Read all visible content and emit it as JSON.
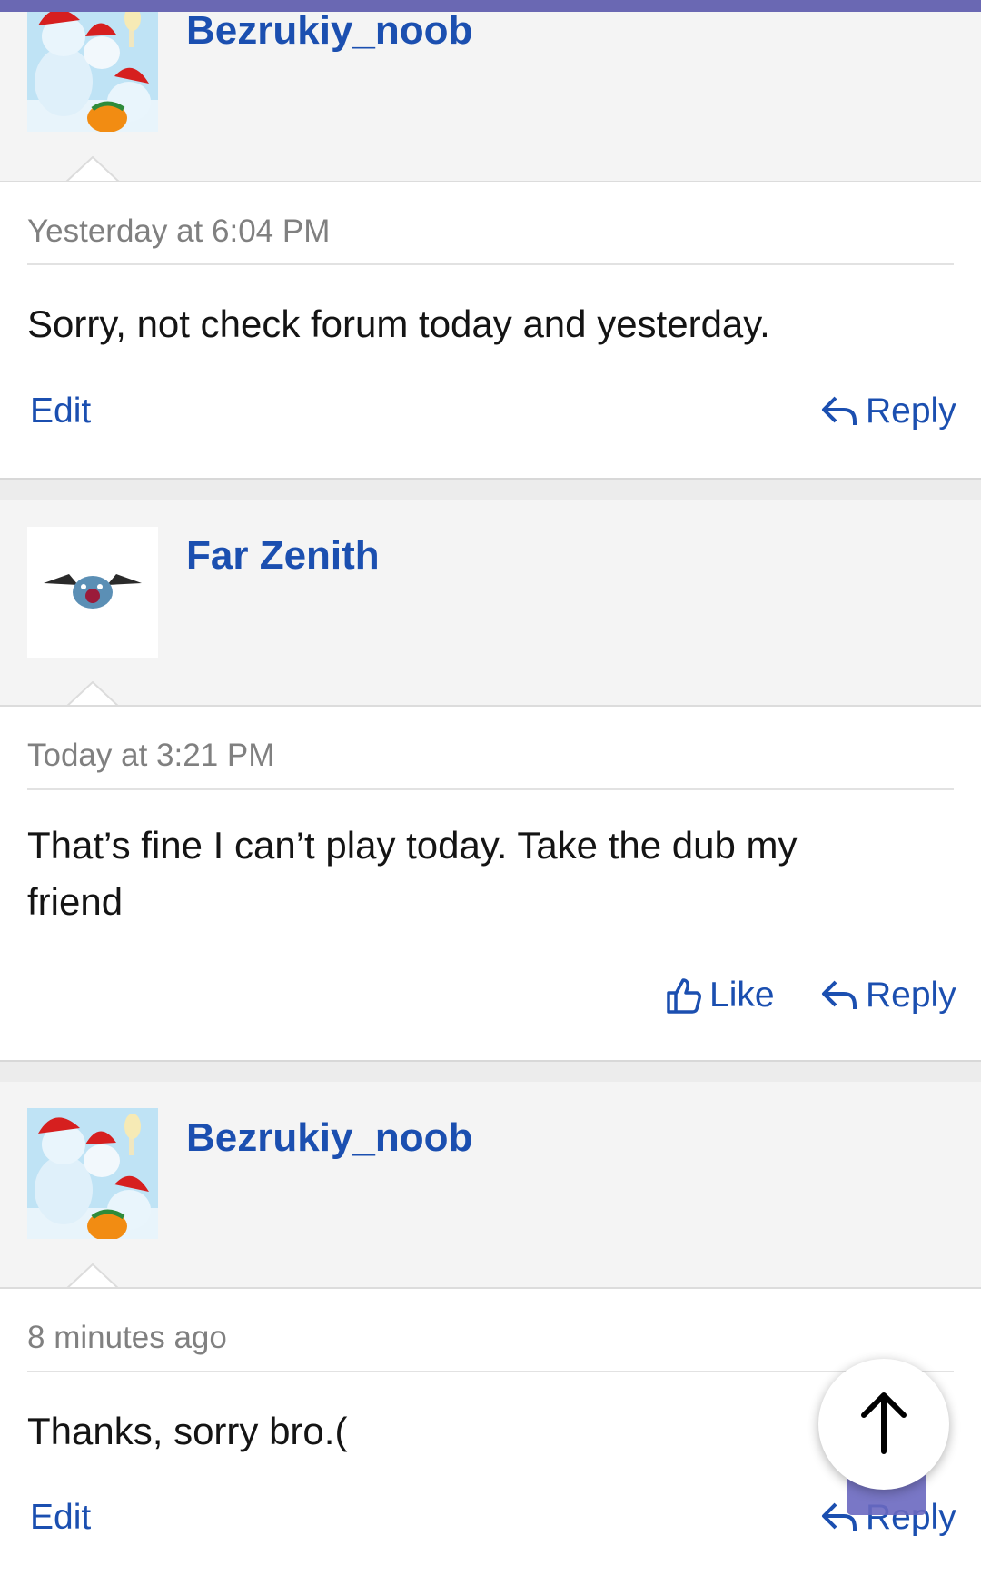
{
  "posts": [
    {
      "username": "Bezrukiy_noob",
      "timestamp": "Yesterday at 6:04 PM",
      "message": "Sorry, not check forum today and yesterday.",
      "actions": {
        "left": "Edit",
        "reply": "Reply"
      }
    },
    {
      "username": "Far Zenith",
      "timestamp": "Today at 3:21 PM",
      "message": "That’s fine I can’t play today. Take the dub my friend",
      "actions": {
        "like": "Like",
        "reply": "Reply"
      }
    },
    {
      "username": "Bezrukiy_noob",
      "timestamp": "8 minutes ago",
      "message": "Thanks, sorry bro.(",
      "actions": {
        "left": "Edit",
        "reply": "Reply"
      }
    }
  ],
  "scroll_top_button": {
    "icon": "arrow-up-icon"
  },
  "colors": {
    "accent": "#1b4fb0",
    "topbar": "#6a68b3",
    "header_bg": "#f4f4f4",
    "meta": "#808080"
  }
}
